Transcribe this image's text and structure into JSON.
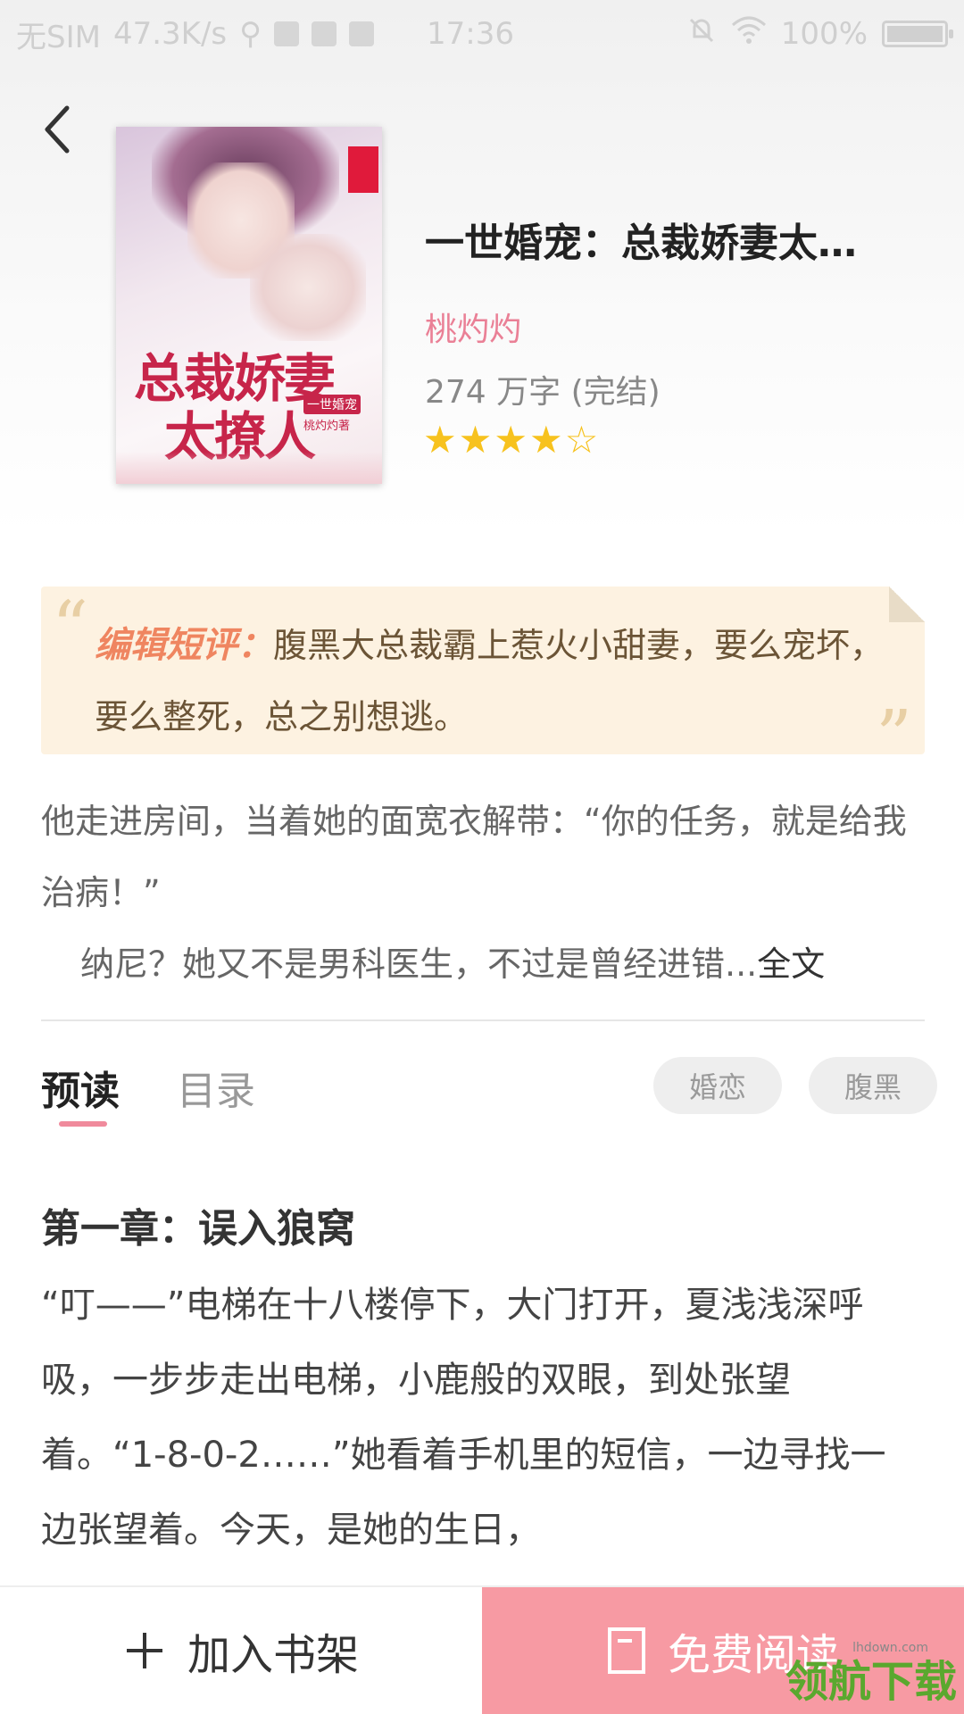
{
  "status_bar": {
    "carrier": "无SIM",
    "speed": "47.3K/s",
    "time": "17:36",
    "battery": "100%"
  },
  "book": {
    "title": "一世婚宠：总裁娇妻太…",
    "author": "桃灼灼",
    "word_count": "274 万字 (完结)",
    "rating_stars": 4,
    "rating_max": 5,
    "cover_title_line1": "总裁娇妻",
    "cover_title_line2": "太撩人",
    "cover_series": "一世婚宠",
    "cover_author": "桃灼灼著"
  },
  "review": {
    "label": "编辑短评：",
    "text": "腹黑大总裁霸上惹火小甜妻，要么宠坏，要么整死，总之别想逃。"
  },
  "summary": {
    "line1": "他走进房间，当着她的面宽衣解带：“你的任务，就是给我治病！”",
    "line2": "纳尼？她又不是男科医生，不过是曾经进错...",
    "full_link": "全文"
  },
  "tabs": [
    {
      "label": "预读",
      "active": true
    },
    {
      "label": "目录",
      "active": false
    }
  ],
  "tags": [
    "婚恋",
    "腹黑"
  ],
  "chapter": {
    "title": "第一章：误入狼窝",
    "text": "“叮——”电梯在十八楼停下，大门打开，夏浅浅深呼吸，一步步走出电梯，小鹿般的双眼，到处张望着。“1-8-0-2……”她看着手机里的短信，一边寻找一边张望着。今天，是她的生日，"
  },
  "bottom_bar": {
    "add_shelf": "加入书架",
    "free_read": "免费阅读"
  },
  "watermark": {
    "text": "领航下载",
    "url": "lhdown.com"
  },
  "colors": {
    "accent_pink": "#f79aa3",
    "author_pink": "#ea8096",
    "star": "#f7c21e",
    "review_bg": "#fdf2e1"
  }
}
